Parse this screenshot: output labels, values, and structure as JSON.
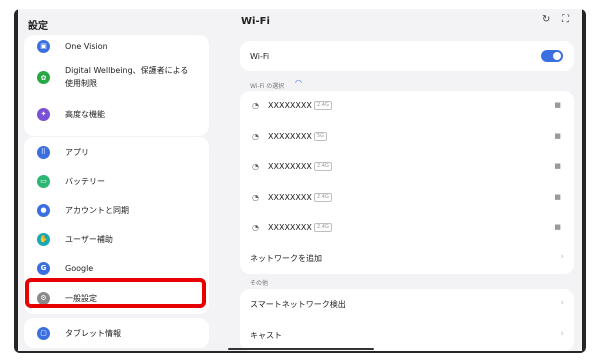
{
  "left_panel": {
    "title": "設定",
    "card1": [
      {
        "label": "One Vision",
        "icon": "one-vision-icon",
        "color": "#3b6fe0"
      },
      {
        "label": "Digital Wellbeing、保護者による",
        "label2": "使用制限",
        "icon": "digital-wellbeing-icon",
        "color": "#28a745"
      },
      {
        "label": "高度な機能",
        "icon": "advanced-features-icon",
        "color": "#7b4fd6"
      }
    ],
    "card2": [
      {
        "label": "アプリ",
        "icon": "apps-icon",
        "color": "#3b6fe0"
      },
      {
        "label": "バッテリー",
        "icon": "battery-icon",
        "color": "#2bb673"
      },
      {
        "label": "アカウントと同期",
        "icon": "account-icon",
        "color": "#3b6fe0"
      },
      {
        "label": "ユーザー補助",
        "icon": "accessibility-icon",
        "color": "#17a8b8"
      },
      {
        "label": "Google",
        "icon": "google-icon",
        "color": "#3b6fe0"
      },
      {
        "label": "一般設定",
        "icon": "general-settings-icon",
        "color": "#8a8a8a"
      }
    ],
    "card3": [
      {
        "label": "タブレット情報",
        "icon": "tablet-info-icon",
        "color": "#3b6fe0"
      }
    ],
    "highlight_color": "#e60000"
  },
  "right_panel": {
    "title": "Wi-Fi",
    "wifi_toggle_label": "Wi-Fi",
    "wifi_toggle_state": "on",
    "select_label": "Wi-Fi の選択",
    "networks": [
      {
        "ssid": "XXXXXXXX",
        "band": "2.4G"
      },
      {
        "ssid": "XXXXXXXX",
        "band": "5G"
      },
      {
        "ssid": "XXXXXXXX",
        "band": "2.4G"
      },
      {
        "ssid": "XXXXXXXX",
        "band": "2.4G"
      },
      {
        "ssid": "XXXXXXXX",
        "band": "2.4G"
      }
    ],
    "add_network_label": "ネットワークを追加",
    "other_label": "その他",
    "other_items": [
      "スマートネットワーク検出",
      "キャスト"
    ],
    "accent_color": "#3b6fe0"
  }
}
